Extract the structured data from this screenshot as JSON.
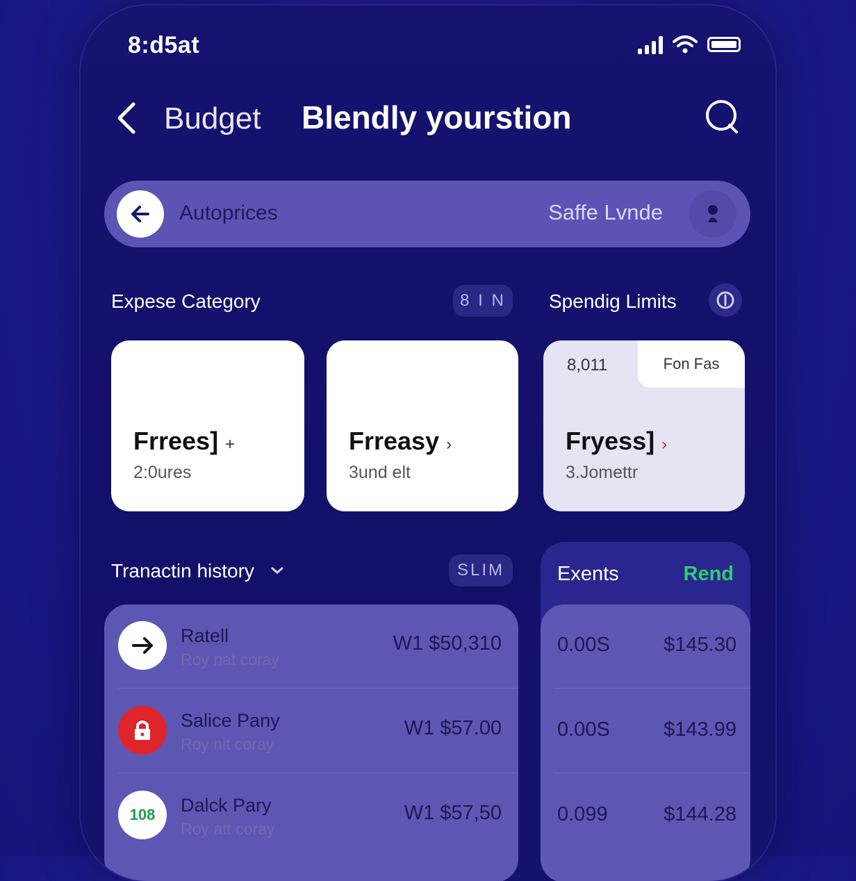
{
  "status_bar": {
    "time": "8:d5at"
  },
  "nav": {
    "section": "Budget",
    "title": "Blendly yourstion"
  },
  "search_bar": {
    "label": "Autoprices",
    "right_text": "Saffe Lvnde"
  },
  "expense": {
    "title": "Expese Category",
    "pill": "8 I N"
  },
  "limits": {
    "title": "Spendig Limits"
  },
  "cards": [
    {
      "title": "Frrees]",
      "arrow": "+",
      "subtitle": "2:0ures"
    },
    {
      "title": "Frreasy",
      "arrow": "›",
      "subtitle": "3und elt"
    },
    {
      "title": "Fryess]",
      "arrow": "›",
      "subtitle": "3.Jomettr",
      "number": "8,011",
      "tag": "Fon Fas"
    }
  ],
  "history": {
    "title": "Tranactin history",
    "pill": "SLIM"
  },
  "transactions": [
    {
      "name": "Ratell",
      "sub": "Roy nat coray",
      "amount": "W1 $50,310",
      "icon": "arrow-right-icon"
    },
    {
      "name": "Salice Pany",
      "sub": "Roy nit coray",
      "amount": "W1 $57.00",
      "icon": "lock-icon"
    },
    {
      "name": "Dalck Pary",
      "sub": "Roy att coray",
      "amount": "W1 $57,50",
      "icon_text": "108",
      "icon": "badge-icon"
    }
  ],
  "events": {
    "title": "Exents",
    "link": "Rend",
    "rows": [
      {
        "a": "0.00S",
        "b": "$145.30"
      },
      {
        "a": "0.00S",
        "b": "$143.99"
      },
      {
        "a": "0.099",
        "b": "$144.28"
      }
    ]
  },
  "colors": {
    "background": "#1c1a8a",
    "panel": "#5d57b4",
    "accent_green": "#2ecc71",
    "accent_red": "#e0242c"
  }
}
